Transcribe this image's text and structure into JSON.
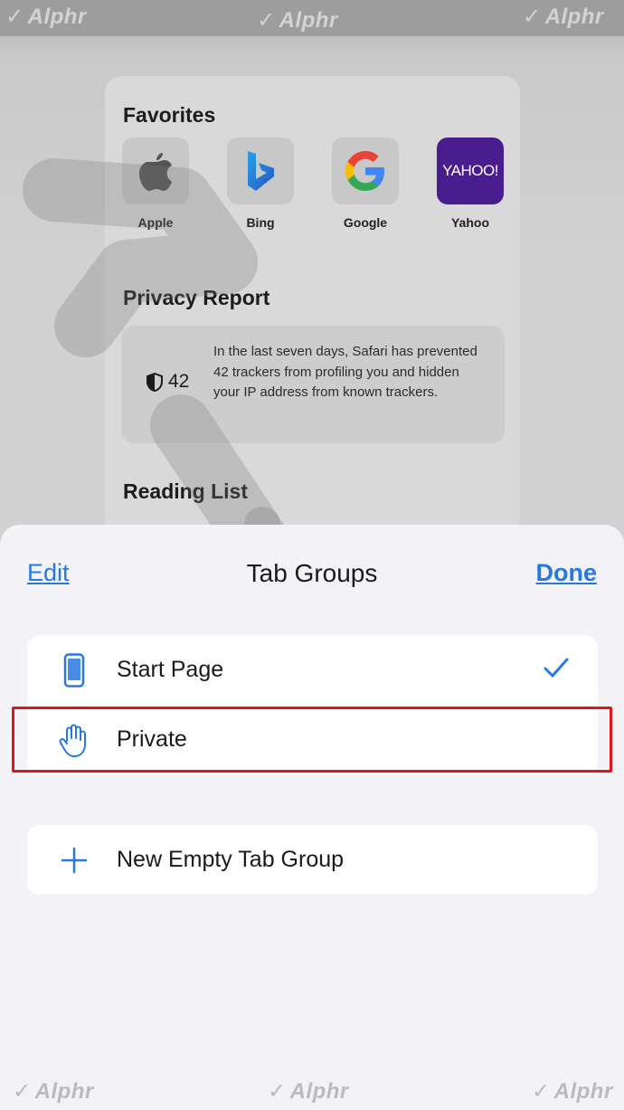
{
  "watermark": {
    "brand": "Alphr",
    "mark": "✓"
  },
  "start_page": {
    "favorites_title": "Favorites",
    "favorites": [
      {
        "label": "Apple",
        "icon": "apple-logo-icon"
      },
      {
        "label": "Bing",
        "icon": "bing-logo-icon"
      },
      {
        "label": "Google",
        "icon": "google-logo-icon"
      },
      {
        "label": "Yahoo",
        "icon": "yahoo-logo-icon",
        "tile_text": "YAHOO!"
      }
    ],
    "privacy_title": "Privacy Report",
    "privacy_count": "42",
    "privacy_text": "In the last seven days, Safari has prevented 42 trackers from profiling you and hidden your IP address from known trackers.",
    "reading_list_title": "Reading List"
  },
  "sheet": {
    "edit_label": "Edit",
    "title": "Tab Groups",
    "done_label": "Done",
    "groups": [
      {
        "label": "Start Page",
        "icon": "phone-icon",
        "selected": true
      },
      {
        "label": "Private",
        "icon": "hand-icon",
        "selected": false
      }
    ],
    "new_group_label": "New Empty Tab Group"
  },
  "colors": {
    "accent": "#2878e0",
    "highlight": "#e0161c",
    "yahoo": "#4a1d8f"
  }
}
